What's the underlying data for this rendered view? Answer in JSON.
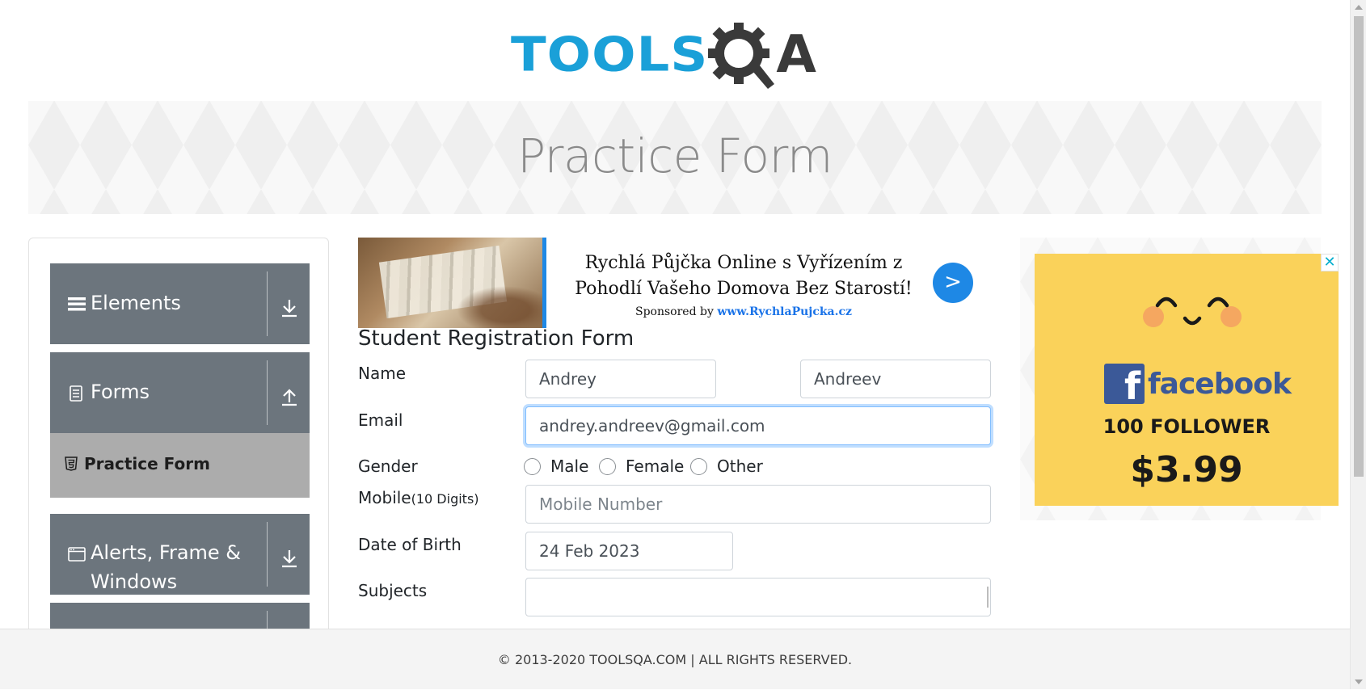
{
  "logo": {
    "text_primary": "TOOLS",
    "text_secondary": "A"
  },
  "banner": {
    "title": "Practice Form"
  },
  "sidebar": {
    "groups": [
      {
        "label": "Elements",
        "icon": "menu-icon",
        "arrow": "download-icon"
      },
      {
        "label": "Forms",
        "icon": "document-icon",
        "arrow": "upload-icon"
      },
      {
        "label": "Alerts, Frame & Windows",
        "icon": "window-icon",
        "arrow": "download-icon"
      }
    ],
    "active_item": {
      "label": "Practice Form",
      "icon": "html5-icon"
    }
  },
  "ad_top": {
    "title": "Rychlá Půjčka Online s Vyřízením z Pohodlí Vašeho Domova Bez Starostí!",
    "sponsor_prefix": "Sponsored by",
    "sponsor_link": "www.RychlaPujcka.cz",
    "button": ">"
  },
  "form": {
    "title": "Student Registration Form",
    "name_label": "Name",
    "first_name": "Andrey",
    "last_name": "Andreev",
    "email_label": "Email",
    "email": "andrey.andreev@gmail.com",
    "gender_label": "Gender",
    "gender_options": [
      "Male",
      "Female",
      "Other"
    ],
    "mobile_label": "Mobile",
    "mobile_hint": "(10 Digits)",
    "mobile_placeholder": "Mobile Number",
    "dob_label": "Date of Birth",
    "dob": "24 Feb 2023",
    "subjects_label": "Subjects",
    "subjects": ""
  },
  "ad_right": {
    "brand": "facebook",
    "followers": "100 FOLLOWER",
    "price": "$3.99",
    "close": "✕",
    "colors": {
      "background": "#fad25a",
      "brand": "#3b5998"
    }
  },
  "footer": {
    "text": "© 2013-2020 TOOLSQA.COM | ALL RIGHTS RESERVED."
  },
  "colors": {
    "sidebar_group": "#6c757d",
    "sidebar_active": "#acacac",
    "accent": "#1e88e5",
    "logo_blue": "#1aa0d8"
  }
}
